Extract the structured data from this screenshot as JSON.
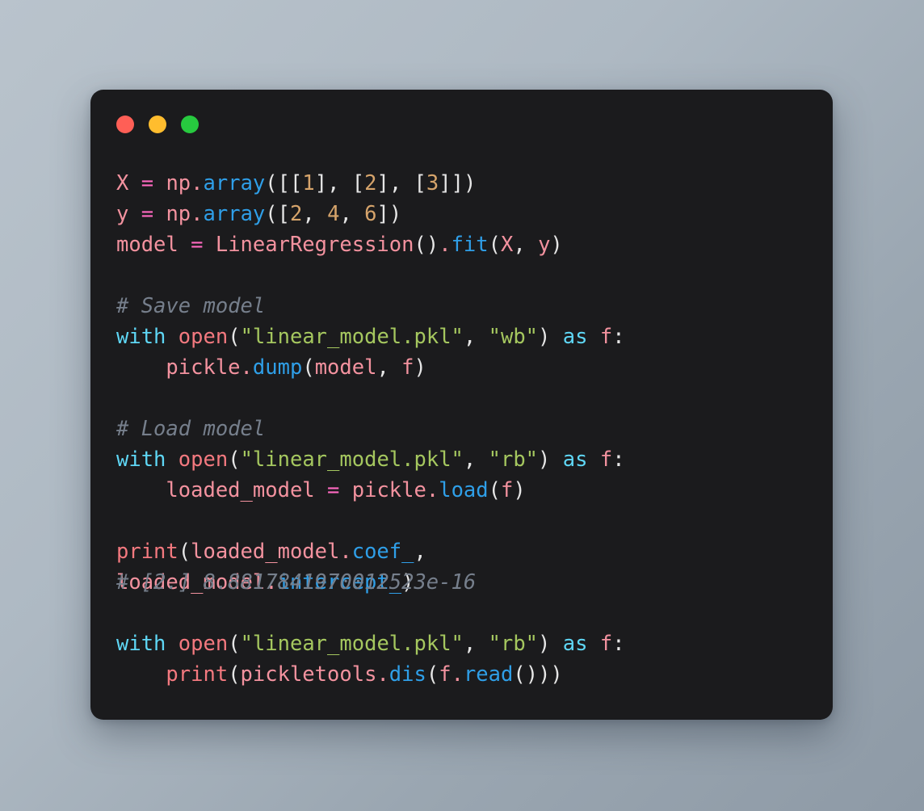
{
  "window": {
    "titlebar": {
      "buttons": [
        {
          "name": "close",
          "label": "",
          "color": "#ff5f56"
        },
        {
          "name": "minimize",
          "label": "",
          "color": "#ffbd2e"
        },
        {
          "name": "zoom",
          "label": "",
          "color": "#27c93f"
        }
      ]
    },
    "background_color": "#1b1b1d",
    "page_background": "#aeb9c3"
  },
  "theme": {
    "identifier": "#f3929f",
    "operator": "#ff6ac1",
    "function": "#2f9fe8",
    "builtin": "#f3797f",
    "keyword": "#5fd7f5",
    "string": "#a5c75f",
    "number": "#d6a46b",
    "punctuation": "#e6e6e6",
    "comment": "#767f8c"
  },
  "code": {
    "language": "python",
    "lines": [
      {
        "n": 1,
        "text": "X = np.array([[1], [2], [3]])",
        "tokens": [
          {
            "t": "X",
            "c": "ident"
          },
          {
            "t": " ",
            "c": "plain"
          },
          {
            "t": "=",
            "c": "op"
          },
          {
            "t": " ",
            "c": "plain"
          },
          {
            "t": "np",
            "c": "ident"
          },
          {
            "t": ".",
            "c": "ident"
          },
          {
            "t": "array",
            "c": "fn"
          },
          {
            "t": "(",
            "c": "punc"
          },
          {
            "t": "[[",
            "c": "punc"
          },
          {
            "t": "1",
            "c": "num"
          },
          {
            "t": "], [",
            "c": "punc"
          },
          {
            "t": "2",
            "c": "num"
          },
          {
            "t": "], [",
            "c": "punc"
          },
          {
            "t": "3",
            "c": "num"
          },
          {
            "t": "]])",
            "c": "punc"
          }
        ]
      },
      {
        "n": 2,
        "text": "y = np.array([2, 4, 6])",
        "tokens": [
          {
            "t": "y",
            "c": "ident"
          },
          {
            "t": " ",
            "c": "plain"
          },
          {
            "t": "=",
            "c": "op"
          },
          {
            "t": " ",
            "c": "plain"
          },
          {
            "t": "np",
            "c": "ident"
          },
          {
            "t": ".",
            "c": "ident"
          },
          {
            "t": "array",
            "c": "fn"
          },
          {
            "t": "(",
            "c": "punc"
          },
          {
            "t": "[",
            "c": "punc"
          },
          {
            "t": "2",
            "c": "num"
          },
          {
            "t": ", ",
            "c": "punc"
          },
          {
            "t": "4",
            "c": "num"
          },
          {
            "t": ", ",
            "c": "punc"
          },
          {
            "t": "6",
            "c": "num"
          },
          {
            "t": "])",
            "c": "punc"
          }
        ]
      },
      {
        "n": 3,
        "text": "model = LinearRegression().fit(X, y)",
        "tokens": [
          {
            "t": "model",
            "c": "ident"
          },
          {
            "t": " ",
            "c": "plain"
          },
          {
            "t": "=",
            "c": "op"
          },
          {
            "t": " ",
            "c": "plain"
          },
          {
            "t": "LinearRegression",
            "c": "ident"
          },
          {
            "t": "()",
            "c": "punc"
          },
          {
            "t": ".",
            "c": "ident"
          },
          {
            "t": "fit",
            "c": "fn"
          },
          {
            "t": "(",
            "c": "punc"
          },
          {
            "t": "X",
            "c": "ident"
          },
          {
            "t": ", ",
            "c": "punc"
          },
          {
            "t": "y",
            "c": "ident"
          },
          {
            "t": ")",
            "c": "punc"
          }
        ]
      },
      {
        "n": 4,
        "text": "",
        "tokens": []
      },
      {
        "n": 5,
        "text": "# Save model",
        "tokens": [
          {
            "t": "# Save model",
            "c": "cmt"
          }
        ]
      },
      {
        "n": 6,
        "text": "with open(\"linear_model.pkl\", \"wb\") as f:",
        "tokens": [
          {
            "t": "with",
            "c": "kw"
          },
          {
            "t": " ",
            "c": "plain"
          },
          {
            "t": "open",
            "c": "builtin"
          },
          {
            "t": "(",
            "c": "punc"
          },
          {
            "t": "\"linear_model.pkl\"",
            "c": "str"
          },
          {
            "t": ", ",
            "c": "punc"
          },
          {
            "t": "\"wb\"",
            "c": "str"
          },
          {
            "t": ")",
            "c": "punc"
          },
          {
            "t": " ",
            "c": "plain"
          },
          {
            "t": "as",
            "c": "kw"
          },
          {
            "t": " ",
            "c": "plain"
          },
          {
            "t": "f",
            "c": "ident"
          },
          {
            "t": ":",
            "c": "punc"
          }
        ]
      },
      {
        "n": 7,
        "text": "    pickle.dump(model, f)",
        "tokens": [
          {
            "t": "    ",
            "c": "plain"
          },
          {
            "t": "pickle",
            "c": "ident"
          },
          {
            "t": ".",
            "c": "ident"
          },
          {
            "t": "dump",
            "c": "fn"
          },
          {
            "t": "(",
            "c": "punc"
          },
          {
            "t": "model",
            "c": "ident"
          },
          {
            "t": ", ",
            "c": "punc"
          },
          {
            "t": "f",
            "c": "ident"
          },
          {
            "t": ")",
            "c": "punc"
          }
        ]
      },
      {
        "n": 8,
        "text": "",
        "tokens": []
      },
      {
        "n": 9,
        "text": "# Load model",
        "tokens": [
          {
            "t": "# Load model",
            "c": "cmt"
          }
        ]
      },
      {
        "n": 10,
        "text": "with open(\"linear_model.pkl\", \"rb\") as f:",
        "tokens": [
          {
            "t": "with",
            "c": "kw"
          },
          {
            "t": " ",
            "c": "plain"
          },
          {
            "t": "open",
            "c": "builtin"
          },
          {
            "t": "(",
            "c": "punc"
          },
          {
            "t": "\"linear_model.pkl\"",
            "c": "str"
          },
          {
            "t": ", ",
            "c": "punc"
          },
          {
            "t": "\"rb\"",
            "c": "str"
          },
          {
            "t": ")",
            "c": "punc"
          },
          {
            "t": " ",
            "c": "plain"
          },
          {
            "t": "as",
            "c": "kw"
          },
          {
            "t": " ",
            "c": "plain"
          },
          {
            "t": "f",
            "c": "ident"
          },
          {
            "t": ":",
            "c": "punc"
          }
        ]
      },
      {
        "n": 11,
        "text": "    loaded_model = pickle.load(f)",
        "tokens": [
          {
            "t": "    ",
            "c": "plain"
          },
          {
            "t": "loaded_model",
            "c": "ident"
          },
          {
            "t": " ",
            "c": "plain"
          },
          {
            "t": "=",
            "c": "op"
          },
          {
            "t": " ",
            "c": "plain"
          },
          {
            "t": "pickle",
            "c": "ident"
          },
          {
            "t": ".",
            "c": "ident"
          },
          {
            "t": "load",
            "c": "fn"
          },
          {
            "t": "(",
            "c": "punc"
          },
          {
            "t": "f",
            "c": "ident"
          },
          {
            "t": ")",
            "c": "punc"
          }
        ]
      },
      {
        "n": 12,
        "text": "",
        "tokens": []
      },
      {
        "n": 13,
        "text": "print(loaded_model.coef_,",
        "tokens": [
          {
            "t": "print",
            "c": "builtin"
          },
          {
            "t": "(",
            "c": "punc"
          },
          {
            "t": "loaded_model",
            "c": "ident"
          },
          {
            "t": ".",
            "c": "ident"
          },
          {
            "t": "coef_",
            "c": "fn"
          },
          {
            "t": ",",
            "c": "punc"
          }
        ]
      },
      {
        "n": 14,
        "overlapping": true,
        "text": "loaded_model.intercept_)",
        "tokens": [
          {
            "t": "loaded_model",
            "c": "ident"
          },
          {
            "t": ".",
            "c": "ident"
          },
          {
            "t": "intercept_",
            "c": "fn"
          },
          {
            "t": ")",
            "c": "punc"
          }
        ],
        "overlay_text": "# [2.] 8.8817841970012523e-16",
        "overlay_tokens": [
          {
            "t": "# [2.] 8.8817841970012523e-16",
            "c": "cmt"
          }
        ]
      },
      {
        "n": 15,
        "text": "",
        "tokens": []
      },
      {
        "n": 16,
        "text": "with open(\"linear_model.pkl\", \"rb\") as f:",
        "tokens": [
          {
            "t": "with",
            "c": "kw"
          },
          {
            "t": " ",
            "c": "plain"
          },
          {
            "t": "open",
            "c": "builtin"
          },
          {
            "t": "(",
            "c": "punc"
          },
          {
            "t": "\"linear_model.pkl\"",
            "c": "str"
          },
          {
            "t": ", ",
            "c": "punc"
          },
          {
            "t": "\"rb\"",
            "c": "str"
          },
          {
            "t": ")",
            "c": "punc"
          },
          {
            "t": " ",
            "c": "plain"
          },
          {
            "t": "as",
            "c": "kw"
          },
          {
            "t": " ",
            "c": "plain"
          },
          {
            "t": "f",
            "c": "ident"
          },
          {
            "t": ":",
            "c": "punc"
          }
        ]
      },
      {
        "n": 17,
        "text": "    print(pickletools.dis(f.read()))",
        "tokens": [
          {
            "t": "    ",
            "c": "plain"
          },
          {
            "t": "print",
            "c": "builtin"
          },
          {
            "t": "(",
            "c": "punc"
          },
          {
            "t": "pickletools",
            "c": "ident"
          },
          {
            "t": ".",
            "c": "ident"
          },
          {
            "t": "dis",
            "c": "fn"
          },
          {
            "t": "(",
            "c": "punc"
          },
          {
            "t": "f",
            "c": "ident"
          },
          {
            "t": ".",
            "c": "ident"
          },
          {
            "t": "read",
            "c": "fn"
          },
          {
            "t": "()))",
            "c": "punc"
          }
        ]
      }
    ]
  }
}
